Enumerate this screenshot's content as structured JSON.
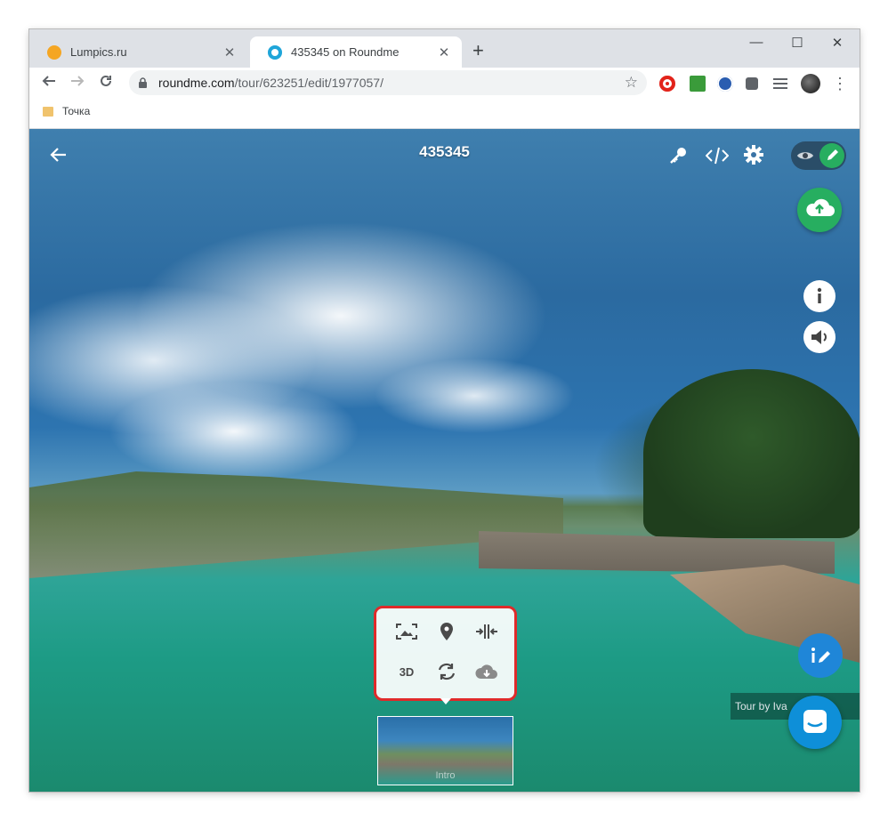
{
  "browser": {
    "tabs": [
      {
        "title": "Lumpics.ru",
        "close": "✕"
      },
      {
        "title": "435345 on Roundme",
        "close": "✕"
      }
    ],
    "new_tab": "+",
    "window_controls": {
      "minimize": "—",
      "maximize": "☐",
      "close": "✕"
    },
    "url_host": "roundme.com",
    "url_path": "/tour/623251/edit/1977057/",
    "bookmarks": [
      {
        "label": "Точка"
      }
    ]
  },
  "viewer": {
    "title": "435345",
    "credit": "Tour by Iva",
    "thumbnail_label": "Intro",
    "tools": {
      "fit_icon": "fit-frame-icon",
      "pin_icon": "map-pin-icon",
      "split_icon": "split-view-icon",
      "three_d": "3D",
      "sync_icon": "refresh-icon",
      "cloud_icon": "cloud-download-icon"
    }
  },
  "colors": {
    "accent_green": "#27ae60",
    "fab_blue": "#1f86d8",
    "highlight_red": "#e02a2a"
  }
}
